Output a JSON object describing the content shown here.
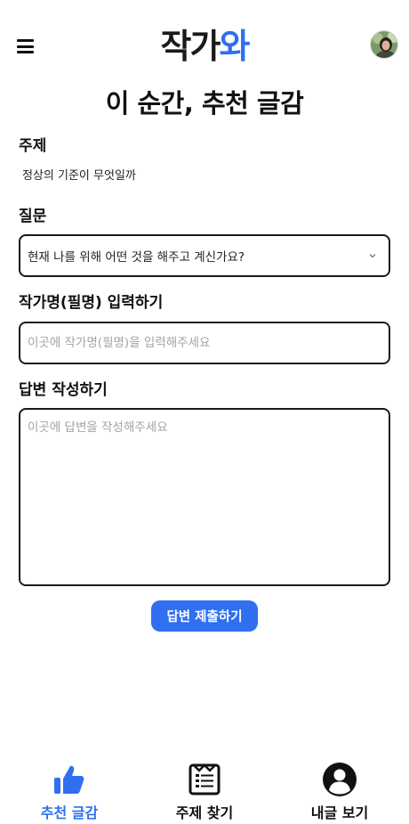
{
  "header": {
    "logo_part1": "작가",
    "logo_part2": "와",
    "menu_icon": "hamburger-menu-icon",
    "avatar_icon": "user-avatar"
  },
  "page": {
    "title": "이 순간, 추천 글감"
  },
  "form": {
    "topic_label": "주제",
    "topic_value": "정상의 기준이 무엇일까",
    "question_label": "질문",
    "question_selected": "현재 나를 위해 어떤 것을 해주고 계신가요?",
    "author_label": "작가명(필명) 입력하기",
    "author_placeholder": "이곳에 작가명(필명)을 입력해주세요",
    "answer_label": "답변 작성하기",
    "answer_placeholder": "이곳에 답변을 작성해주세요",
    "submit_label": "답변 제출하기"
  },
  "bottom_nav": {
    "items": [
      {
        "label": "추천 글감",
        "icon": "thumbs-up-icon",
        "active": true
      },
      {
        "label": "주제 찾기",
        "icon": "document-list-icon",
        "active": false
      },
      {
        "label": "내글 보기",
        "icon": "user-circle-icon",
        "active": false
      }
    ]
  },
  "colors": {
    "accent": "#2f6ff0",
    "text": "#111111",
    "border": "#1a1a1a",
    "placeholder": "#a3a3a3"
  }
}
